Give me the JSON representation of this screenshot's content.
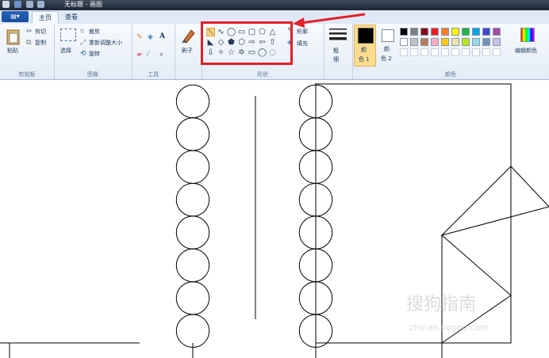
{
  "titlebar": {
    "title": "无标题 - 画图"
  },
  "tabs": {
    "file": "▤▾",
    "home": "主页",
    "view": "查看"
  },
  "clipboard": {
    "paste": "粘贴",
    "cut": "剪切",
    "copy": "复制",
    "group": "剪贴板"
  },
  "image": {
    "select": "选择",
    "crop": "裁剪",
    "resize": "重新调整大小",
    "rotate": "旋转",
    "group": "图像"
  },
  "tools": {
    "group": "工具"
  },
  "brushes": {
    "label": "刷子"
  },
  "shapes": {
    "outline": "轮廓",
    "fill": "填充",
    "group": "形状",
    "row1": [
      "⟍",
      "∿",
      "◯",
      "▭",
      "▢",
      "⬠",
      "△"
    ],
    "row2": [
      "◣",
      "◇",
      "⬟",
      "⬡",
      "⇨",
      "⇦",
      "⇧"
    ],
    "row3": [
      "⇩",
      "✧",
      "☆",
      "✡",
      "▭",
      "◯",
      "◌"
    ]
  },
  "size": {
    "label1": "粗",
    "label2": "细"
  },
  "colors": {
    "color1": "颜",
    "color1b": "色 1",
    "color2": "颜",
    "color2b": "色 2",
    "edit": "编辑颜色",
    "group": "颜色",
    "palette_row1": [
      "#000000",
      "#7f7f7f",
      "#880015",
      "#ed1c24",
      "#ff7f27",
      "#fff200",
      "#22b14c",
      "#00a2e8",
      "#3f48cc",
      "#a349a4"
    ],
    "palette_row2": [
      "#ffffff",
      "#c3c3c3",
      "#b97a57",
      "#ffaec9",
      "#ffc90e",
      "#efe4b0",
      "#b5e61d",
      "#99d9ea",
      "#7092be",
      "#c8bfe7"
    ]
  },
  "watermark": {
    "main": "搜狗指南",
    "sub": "zhinan.sogou.com"
  }
}
